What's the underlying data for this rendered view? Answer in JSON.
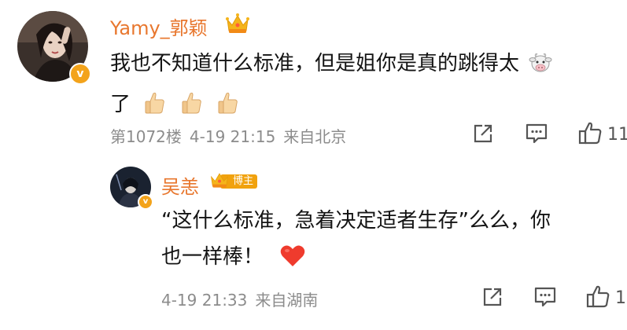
{
  "comments": [
    {
      "username": "Yamy_郭颖",
      "text_lines": [
        "我也不知道什么标准，但是姐你是真的跳得太",
        "了"
      ],
      "meta": {
        "floor": "第1072楼",
        "time": "4-19 21:15",
        "location": "来自北京"
      },
      "likes": "11",
      "verified_badge": "v"
    },
    {
      "username": "吴恙",
      "host_badge": "博主",
      "text_lines": [
        "“这什么标准，急着决定适者生存”么么，你",
        "也一样棒！"
      ],
      "meta": {
        "time": "4-19 21:33",
        "location": "来自湖南"
      },
      "likes": "1",
      "verified_badge": "v"
    }
  ],
  "colors": {
    "username": "#e8772e",
    "text": "#141414",
    "meta": "#8c8c8c",
    "verified": "#f3a31b",
    "heart": "#ef3b2d"
  },
  "icons": [
    "crown-icon",
    "cow-emoji-icon",
    "thumbs-up-emoji-icon",
    "heart-emoji-icon",
    "share-icon",
    "comment-icon",
    "like-icon"
  ]
}
